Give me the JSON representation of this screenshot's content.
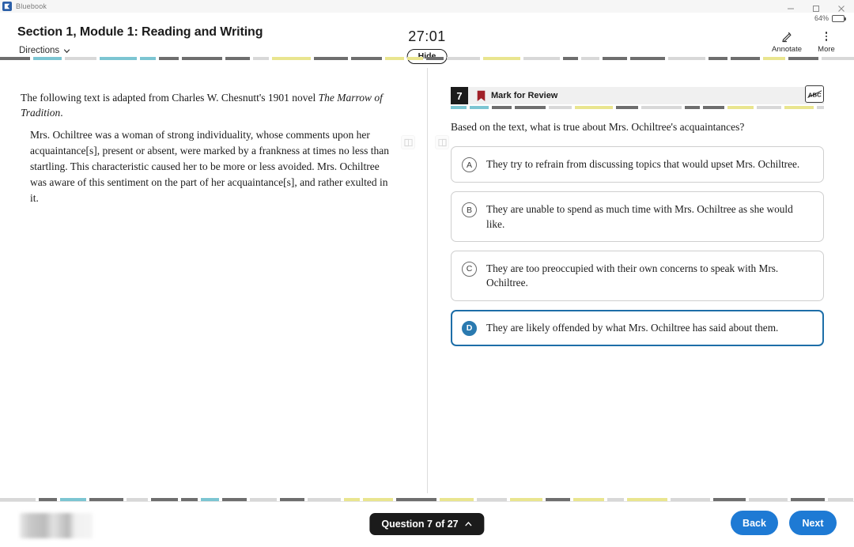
{
  "window": {
    "app_name": "Bluebook",
    "logo_icon": "bluebook-logo-icon",
    "minimize_icon": "minimize-icon",
    "maximize_icon": "maximize-icon",
    "close_icon": "close-icon"
  },
  "battery": {
    "percent_label": "64%",
    "level": 64,
    "icon": "battery-icon"
  },
  "header": {
    "section_title": "Section 1, Module 1: Reading and Writing",
    "directions_label": "Directions",
    "directions_chevron_icon": "chevron-down-icon",
    "timer": "27:01",
    "hide_label": "Hide",
    "tools": [
      {
        "label": "Annotate",
        "icon": "pencil-highlighter-icon"
      },
      {
        "label": "More",
        "icon": "more-vertical-icon"
      }
    ]
  },
  "panels": {
    "expand_left_icon": "expand-left-panel-icon",
    "expand_right_icon": "expand-right-panel-icon"
  },
  "passage": {
    "lead_before": "The following text is adapted from Charles W. Chesnutt's 1901 novel ",
    "lead_title": "The Marrow of Tradition",
    "lead_after": ".",
    "paragraph": "Mrs. Ochiltree was a woman of strong individuality, whose comments upon her acquaintance[s], present or absent, were marked by a frankness at times no less than startling. This characteristic caused her to be more or less avoided. Mrs. Ochiltree was aware of this sentiment on the part of her acquaintance[s], and rather exulted in it."
  },
  "question": {
    "number": "7",
    "bookmark_icon": "bookmark-flag-icon",
    "mark_for_review_label": "Mark for Review",
    "cross_out_icon": "abc-strikethrough-icon",
    "cross_out_label": "ABC",
    "prompt": "Based on the text, what is true about Mrs. Ochiltree's acquaintances?",
    "choices": [
      {
        "letter": "A",
        "text": "They try to refrain from discussing topics that would upset Mrs. Ochiltree.",
        "selected": false
      },
      {
        "letter": "B",
        "text": "They are unable to spend as much time with Mrs. Ochiltree as she would like.",
        "selected": false
      },
      {
        "letter": "C",
        "text": "They are too preoccupied with their own concerns to speak with Mrs. Ochiltree.",
        "selected": false
      },
      {
        "letter": "D",
        "text": "They are likely offended by what Mrs. Ochiltree has said about them.",
        "selected": true
      }
    ]
  },
  "footer": {
    "student_name_redacted": "",
    "question_nav_label": "Question 7 of 27",
    "question_nav_chevron_icon": "chevron-up-icon",
    "back_label": "Back",
    "next_label": "Next"
  },
  "colors": {
    "accent_blue": "#1e7ad4",
    "selected_border": "#1d6ea8",
    "selected_bubble": "#2a7ab0",
    "bookmark_red": "#a02028",
    "qnum_black": "#1b1b1b",
    "rule_dark": "#6e6e6e",
    "rule_light": "#d8d8d8",
    "rule_yellow": "#e9e58f",
    "rule_teal": "#7cc5d2"
  }
}
